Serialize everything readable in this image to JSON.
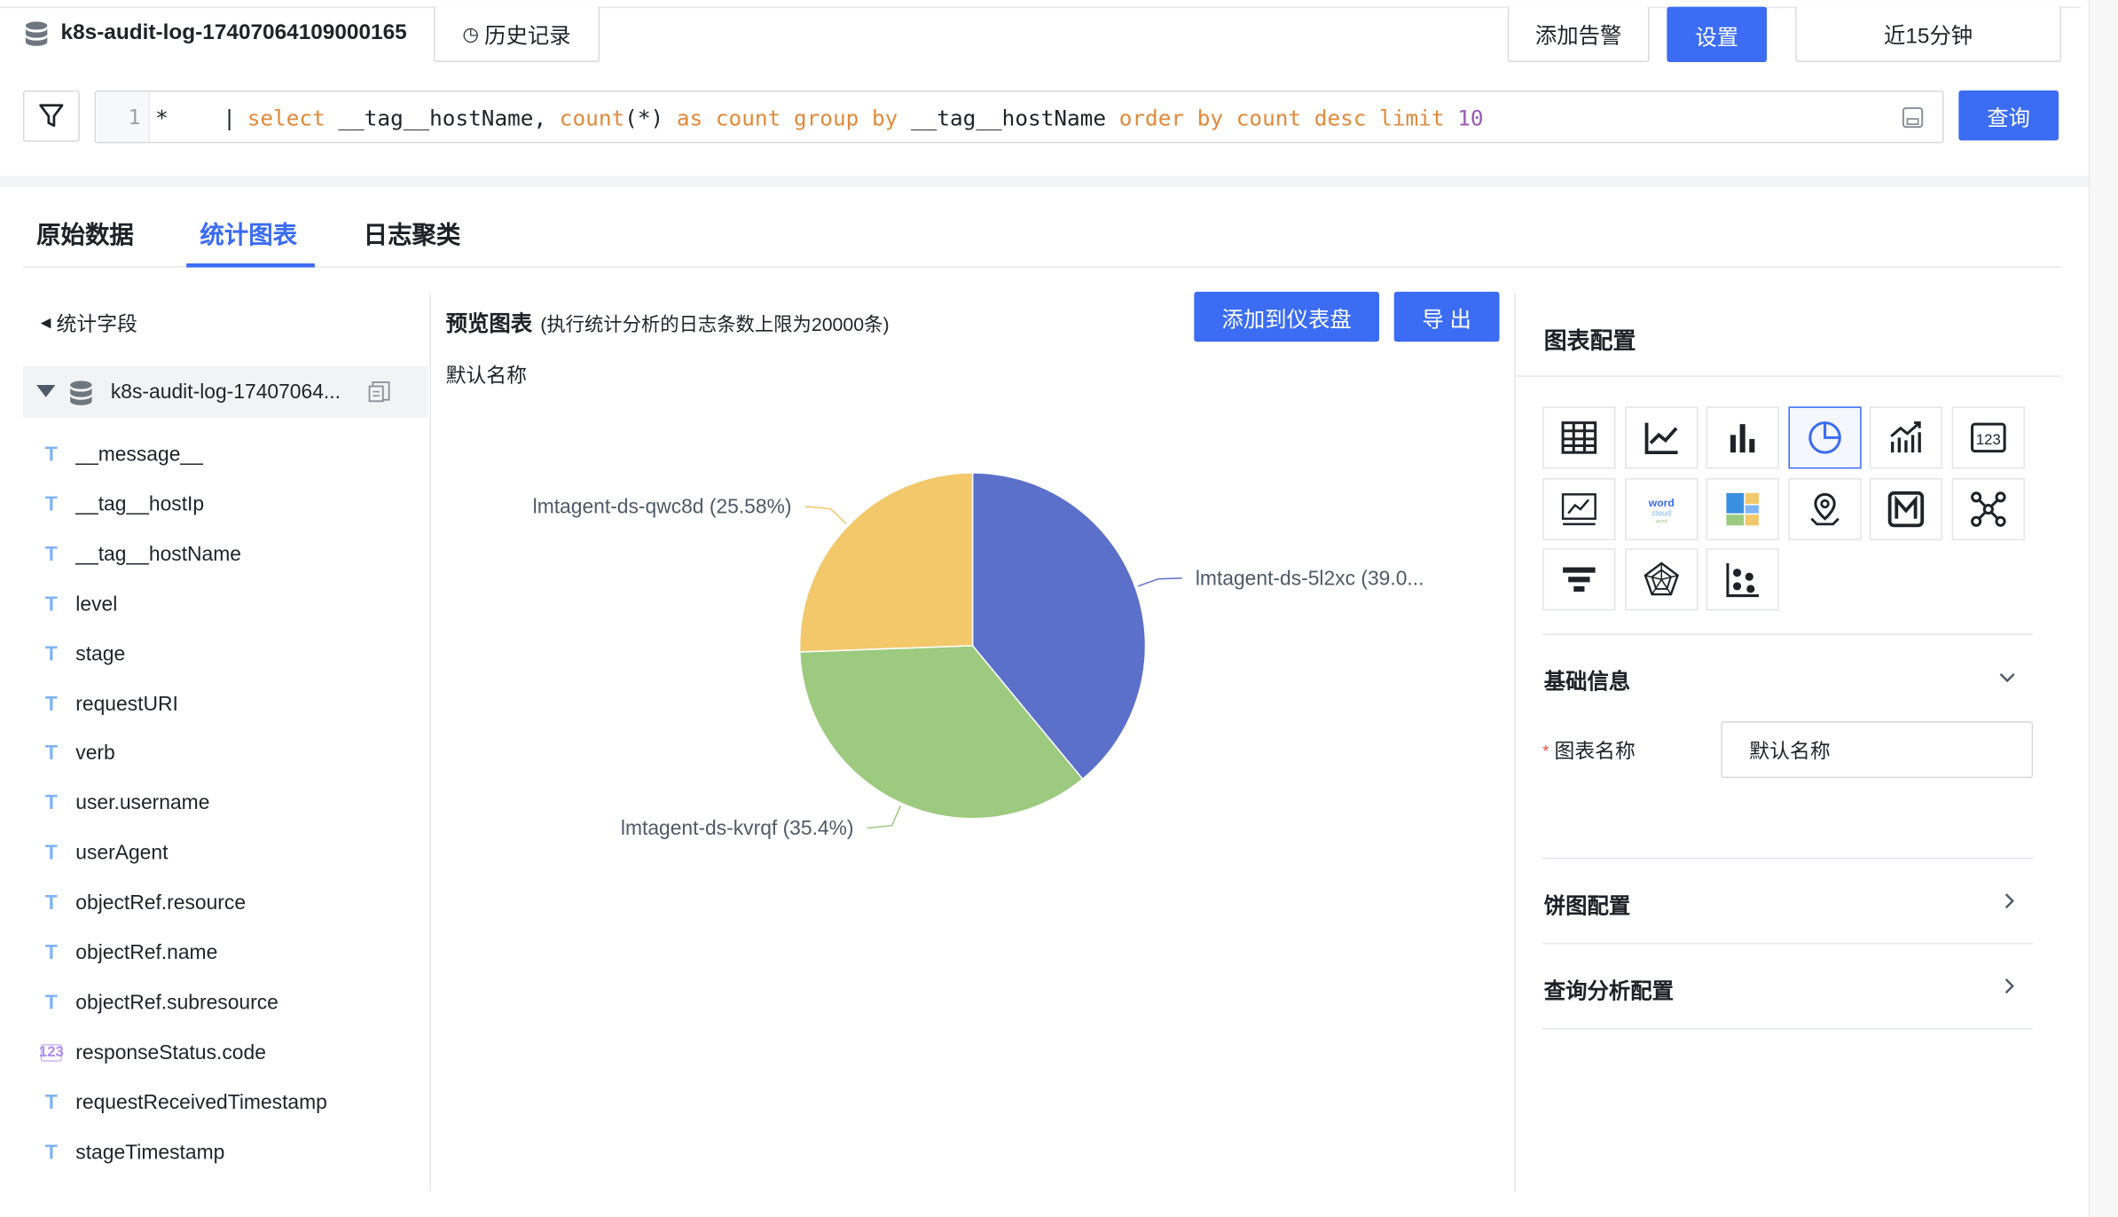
{
  "header": {
    "logstore_name": "k8s-audit-log-17407064109000165",
    "history_label": "历史记录",
    "add_alert_label": "添加告警",
    "settings_label": "设置",
    "time_range_label": "近15分钟"
  },
  "query": {
    "line_number": "1",
    "search_part": "*",
    "pipe": "|",
    "tokens": [
      {
        "t": "select",
        "c": "kw"
      },
      {
        "t": " __tag__hostName, ",
        "c": "id"
      },
      {
        "t": "count",
        "c": "kw"
      },
      {
        "t": "(*) ",
        "c": "id"
      },
      {
        "t": "as",
        "c": "kw"
      },
      {
        "t": " ",
        "c": "id"
      },
      {
        "t": "count",
        "c": "kw"
      },
      {
        "t": " ",
        "c": "id"
      },
      {
        "t": "group by",
        "c": "kw"
      },
      {
        "t": " __tag__hostName ",
        "c": "id"
      },
      {
        "t": "order by",
        "c": "kw"
      },
      {
        "t": " ",
        "c": "id"
      },
      {
        "t": "count",
        "c": "kw"
      },
      {
        "t": " ",
        "c": "id"
      },
      {
        "t": "desc",
        "c": "kw"
      },
      {
        "t": " ",
        "c": "id"
      },
      {
        "t": "limit",
        "c": "kw"
      },
      {
        "t": " ",
        "c": "id"
      },
      {
        "t": "10",
        "c": "num"
      }
    ],
    "search_button_label": "查询"
  },
  "tabs": [
    {
      "label": "原始数据",
      "active": false
    },
    {
      "label": "统计图表",
      "active": true
    },
    {
      "label": "日志聚类",
      "active": false
    }
  ],
  "left_panel": {
    "title": "统计字段",
    "logstore_short": "k8s-audit-log-17407064...",
    "fields": [
      {
        "name": "__message__",
        "type": "T"
      },
      {
        "name": "__tag__hostIp",
        "type": "T"
      },
      {
        "name": "__tag__hostName",
        "type": "T"
      },
      {
        "name": "level",
        "type": "T"
      },
      {
        "name": "stage",
        "type": "T"
      },
      {
        "name": "requestURI",
        "type": "T"
      },
      {
        "name": "verb",
        "type": "T"
      },
      {
        "name": "user.username",
        "type": "T"
      },
      {
        "name": "userAgent",
        "type": "T"
      },
      {
        "name": "objectRef.resource",
        "type": "T"
      },
      {
        "name": "objectRef.name",
        "type": "T"
      },
      {
        "name": "objectRef.subresource",
        "type": "T"
      },
      {
        "name": "responseStatus.code",
        "type": "123"
      },
      {
        "name": "requestReceivedTimestamp",
        "type": "T"
      },
      {
        "name": "stageTimestamp",
        "type": "T"
      }
    ]
  },
  "preview": {
    "title": "预览图表",
    "note": "(执行统计分析的日志条数上限为20000条)",
    "add_dashboard_label": "添加到仪表盘",
    "export_label": "导 出",
    "chart_name": "默认名称"
  },
  "chart_data": {
    "type": "pie",
    "title": "默认名称",
    "slices": [
      {
        "label": "lmtagent-ds-5l2xc (39.0...",
        "value": 39.02,
        "color": "#5b70c9"
      },
      {
        "label": "lmtagent-ds-kvrqf (35.4%)",
        "value": 35.4,
        "color": "#9cca7e"
      },
      {
        "label": "lmtagent-ds-qwc8d (25.58%)",
        "value": 25.58,
        "color": "#f2c86b"
      }
    ]
  },
  "config": {
    "title": "图表配置",
    "chart_types": [
      "table-icon",
      "line-chart-icon",
      "bar-chart-icon",
      "pie-chart-icon",
      "trend-chart-icon",
      "number-icon",
      "flow-chart-icon",
      "word-cloud-icon",
      "treemap-icon",
      "map-icon",
      "markdown-icon",
      "topology-icon",
      "funnel-icon",
      "radar-icon",
      "scatter-icon"
    ],
    "basic_info_label": "基础信息",
    "chart_name_label": "图表名称",
    "required_mark": "*",
    "chart_name_value": "默认名称",
    "pie_config_label": "饼图配置",
    "query_config_label": "查询分析配置",
    "word_cloud_text": "word cloud"
  },
  "colors": {
    "accent": "#3b6cf3",
    "keyword": "#e08a3a",
    "number": "#9b59b6"
  }
}
